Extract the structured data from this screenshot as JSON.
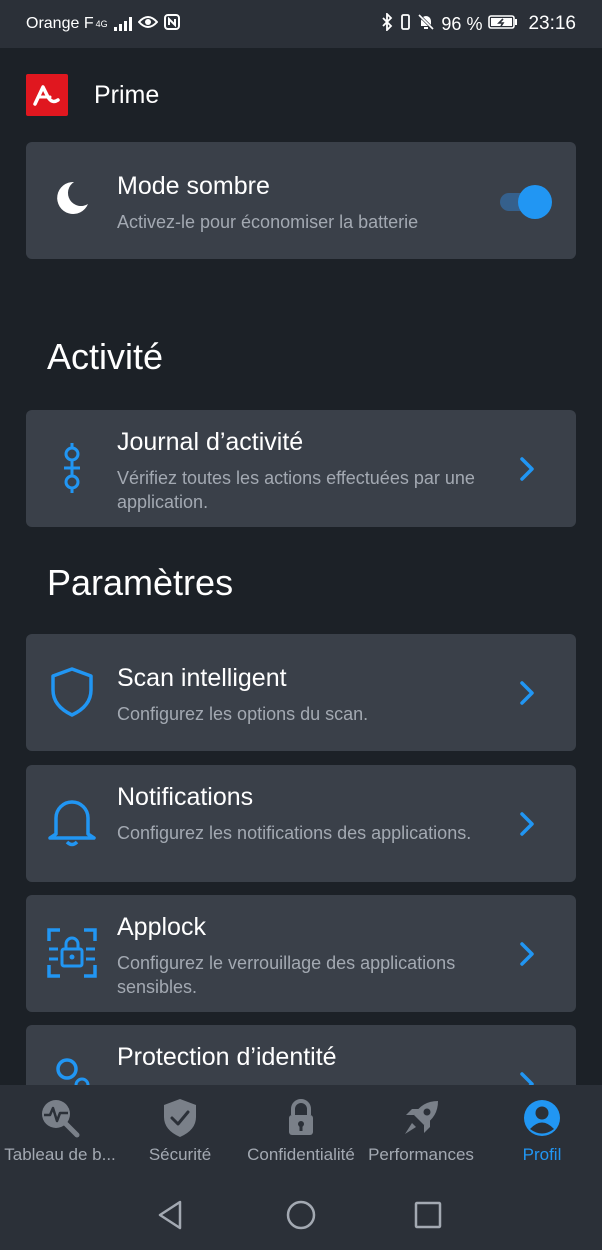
{
  "status_bar": {
    "carrier": "Orange F",
    "network": "4G",
    "battery": "96 %",
    "time": "23:16"
  },
  "app": {
    "title": "Prime"
  },
  "dark_mode": {
    "title": "Mode sombre",
    "subtitle": "Activez-le pour économiser la batterie",
    "enabled": true
  },
  "sections": {
    "activity": "Activité",
    "settings": "Paramètres"
  },
  "activity_items": [
    {
      "title": "Journal d’activité",
      "subtitle": "Vérifiez toutes les actions effectuées par une application.",
      "icon": "activity-log-icon"
    }
  ],
  "settings_items": [
    {
      "title": "Scan intelligent",
      "subtitle": "Configurez les options du scan.",
      "icon": "shield-icon"
    },
    {
      "title": "Notifications",
      "subtitle": "Configurez les notifications des applications.",
      "icon": "bell-icon"
    },
    {
      "title": "Applock",
      "subtitle": "Configurez le verrouillage des applications sensibles.",
      "icon": "applock-icon"
    },
    {
      "title": "Protection d’identité",
      "subtitle": "",
      "icon": "identity-icon"
    }
  ],
  "bottom_nav": [
    {
      "label": "Tableau de b...",
      "icon": "dashboard-icon",
      "active": false
    },
    {
      "label": "Sécurité",
      "icon": "security-shield-icon",
      "active": false
    },
    {
      "label": "Confidentialité",
      "icon": "lock-icon",
      "active": false
    },
    {
      "label": "Performances",
      "icon": "rocket-icon",
      "active": false
    },
    {
      "label": "Profil",
      "icon": "profile-icon",
      "active": true
    }
  ],
  "colors": {
    "background": "#1c2127",
    "card": "#3a4049",
    "accent": "#2196f3",
    "logo": "#e0171f",
    "muted_text": "#a3a9b2"
  }
}
